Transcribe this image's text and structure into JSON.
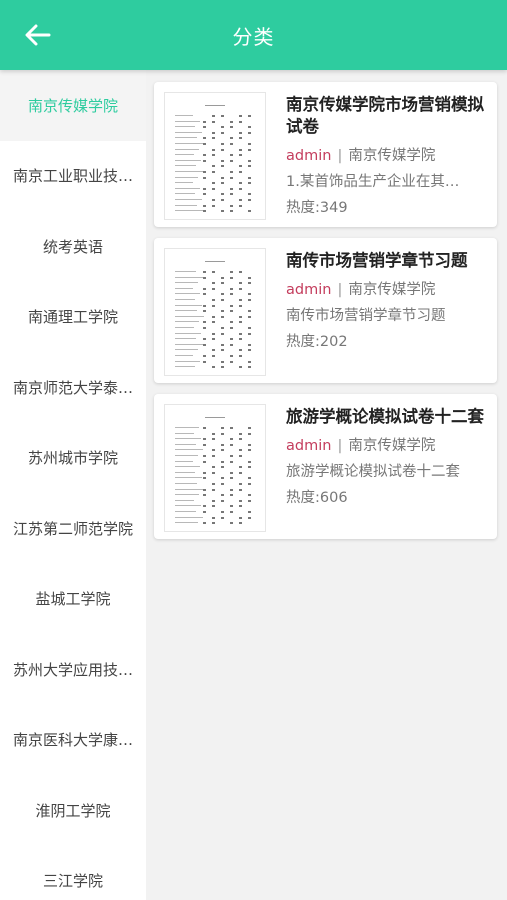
{
  "header": {
    "title": "分类"
  },
  "colors": {
    "accent": "#2ecc9f",
    "author": "#c43d5d"
  },
  "sidebar": {
    "items": [
      {
        "label": "南京传媒学院",
        "active": true
      },
      {
        "label": "南京工业职业技…",
        "active": false
      },
      {
        "label": "统考英语",
        "active": false
      },
      {
        "label": "南通理工学院",
        "active": false
      },
      {
        "label": "南京师范大学泰…",
        "active": false
      },
      {
        "label": "苏州城市学院",
        "active": false
      },
      {
        "label": "江苏第二师范学院",
        "active": false
      },
      {
        "label": "盐城工学院",
        "active": false
      },
      {
        "label": "苏州大学应用技…",
        "active": false
      },
      {
        "label": "南京医科大学康…",
        "active": false
      },
      {
        "label": "淮阴工学院",
        "active": false
      },
      {
        "label": "三江学院",
        "active": false
      }
    ]
  },
  "cards": [
    {
      "title": "南京传媒学院市场营销模拟试卷",
      "author": "admin",
      "separator": "|",
      "school": "南京传媒学院",
      "desc": "1.某首饰品生产企业在其…",
      "hot": "热度:349"
    },
    {
      "title": "南传市场营销学章节习题",
      "author": "admin",
      "separator": "|",
      "school": "南京传媒学院",
      "desc": "南传市场营销学章节习题",
      "hot": "热度:202"
    },
    {
      "title": "旅游学概论模拟试卷十二套",
      "author": "admin",
      "separator": "|",
      "school": "南京传媒学院",
      "desc": "旅游学概论模拟试卷十二套",
      "hot": "热度:606"
    }
  ]
}
